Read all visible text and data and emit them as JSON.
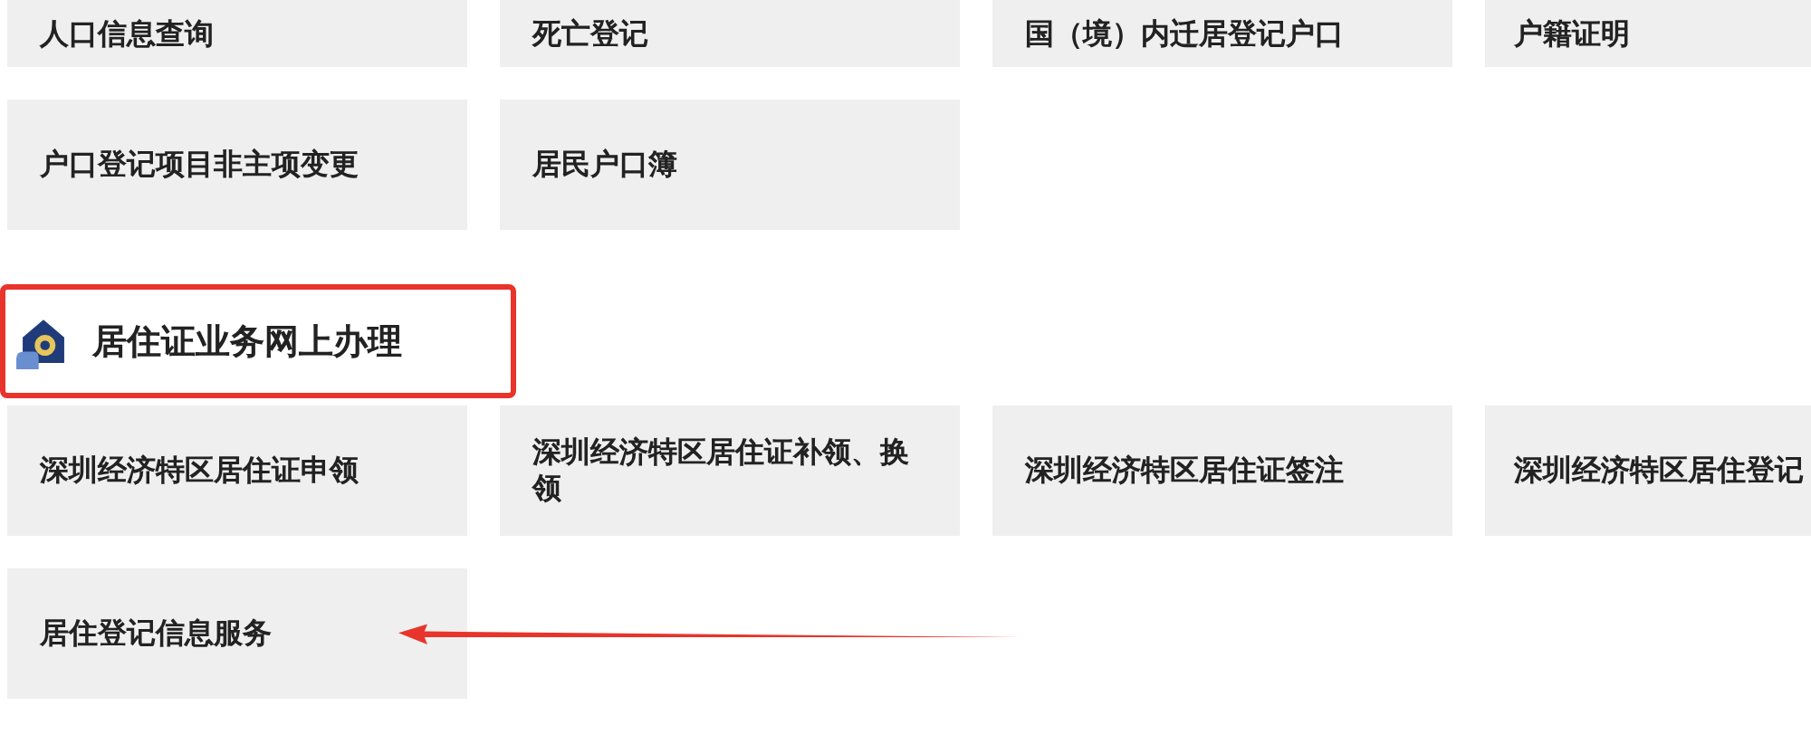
{
  "sections": [
    {
      "items": [
        {
          "label": "人口信息查询",
          "pointed": false
        },
        {
          "label": "死亡登记",
          "pointed": false
        },
        {
          "label": "国（境）内迁居登记户口",
          "pointed": false
        },
        {
          "label": "户籍证明",
          "pointed": false
        },
        {
          "label": "户口登记项目非主项变更",
          "pointed": false
        },
        {
          "label": "居民户口簿",
          "pointed": false
        }
      ]
    },
    {
      "title": "居住证业务网上办理",
      "highlighted": true,
      "items": [
        {
          "label": "深圳经济特区居住证申领",
          "pointed": false
        },
        {
          "label": "深圳经济特区居住证补领、换领",
          "pointed": false
        },
        {
          "label": "深圳经济特区居住证签注",
          "pointed": false
        },
        {
          "label": "深圳经济特区居住登记",
          "pointed": false
        },
        {
          "label": "居住登记信息服务",
          "pointed": true
        }
      ]
    }
  ]
}
